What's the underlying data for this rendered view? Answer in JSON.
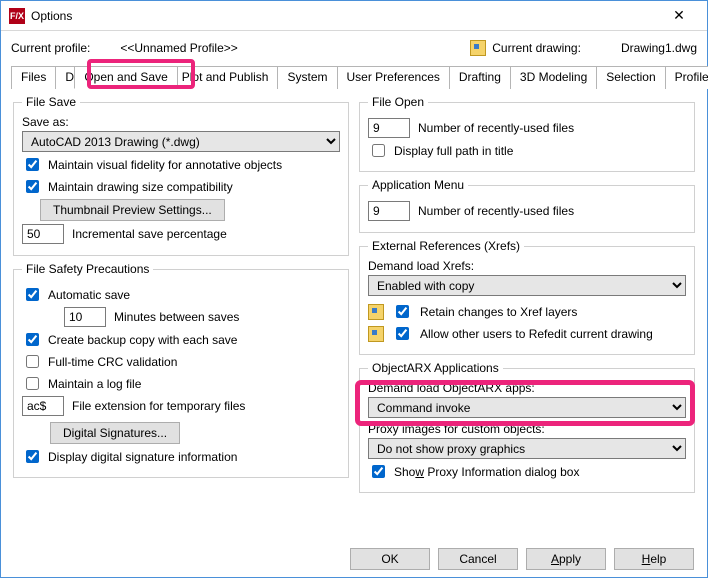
{
  "window": {
    "title": "Options"
  },
  "profile": {
    "label": "Current profile:",
    "name": "<<Unnamed Profile>>",
    "drawing_label": "Current drawing:",
    "drawing_name": "Drawing1.dwg"
  },
  "tabs": {
    "files": "Files",
    "display": "Display",
    "open_save": "Open and Save",
    "plot_publish": "Plot and Publish",
    "system": "System",
    "user_prefs": "User Preferences",
    "drafting": "Drafting",
    "modeling": "3D Modeling",
    "selection": "Selection",
    "profiles": "Profiles"
  },
  "left": {
    "file_save": {
      "legend": "File Save",
      "save_as_label": "Save as:",
      "save_as_value": "AutoCAD 2013 Drawing (*.dwg)",
      "maintain_fidelity": "Maintain visual fidelity for annotative objects",
      "maintain_compat": "Maintain drawing size compatibility",
      "thumb_btn": "Thumbnail Preview Settings...",
      "inc_save_value": "50",
      "inc_save_label": "Incremental save percentage"
    },
    "safety": {
      "legend": "File Safety Precautions",
      "autosave": "Automatic save",
      "autosave_value": "10",
      "autosave_label": "Minutes between saves",
      "backup": "Create backup copy with each save",
      "crc": "Full-time CRC validation",
      "logfile": "Maintain a log file",
      "temp_ext_value": "ac$",
      "temp_ext_label": "File extension for temporary files",
      "digsig_btn": "Digital Signatures...",
      "show_digsig": "Display digital signature information"
    }
  },
  "right": {
    "file_open": {
      "legend": "File Open",
      "recent_value": "9",
      "recent_label": "Number of recently-used files",
      "full_path": "Display full path in title"
    },
    "app_menu": {
      "legend": "Application Menu",
      "recent_value": "9",
      "recent_label": "Number of recently-used files"
    },
    "xrefs": {
      "legend": "External References (Xrefs)",
      "demand_label": "Demand load Xrefs:",
      "demand_value": "Enabled with copy",
      "retain": "Retain changes to Xref layers",
      "allow_refedit": "Allow other users to Refedit current drawing"
    },
    "arx": {
      "legend": "ObjectARX Applications",
      "demand_label": "Demand load ObjectARX apps:",
      "demand_value": "Command invoke",
      "proxy_label": "Proxy images for custom objects:",
      "proxy_value": "Do not show proxy graphics",
      "show_proxy": "Show Proxy Information dialog box"
    }
  },
  "footer": {
    "ok": "OK",
    "cancel": "Cancel",
    "apply": "Apply",
    "help": "Help"
  }
}
